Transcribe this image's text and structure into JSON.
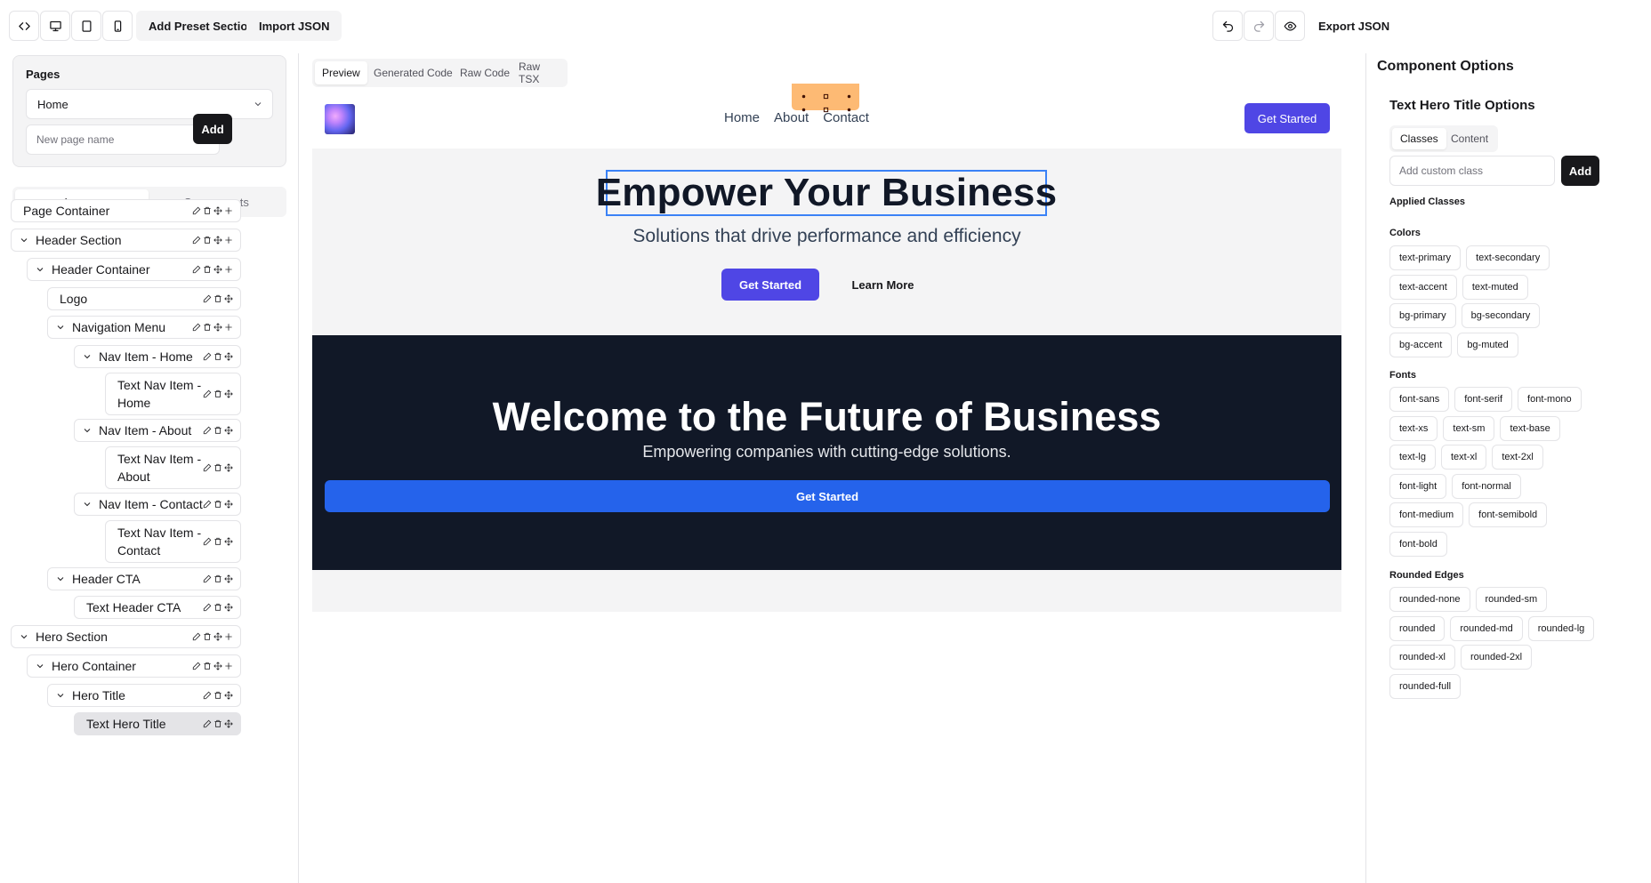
{
  "toolbar": {
    "add_preset": "Add Preset Section",
    "import_json": "Import JSON",
    "export_json": "Export JSON"
  },
  "sidebar": {
    "pages_title": "Pages",
    "selected_page": "Home",
    "new_page_placeholder": "New page name",
    "add_label": "Add",
    "tabs": [
      "Layers",
      "Components"
    ],
    "layers": [
      {
        "label": "Page Container"
      },
      {
        "label": "Header Section"
      },
      {
        "label": "Header Container"
      },
      {
        "label": "Logo"
      },
      {
        "label": "Navigation Menu"
      },
      {
        "label": "Nav Item - Home"
      },
      {
        "label": "Text Nav Item - Home"
      },
      {
        "label": "Nav Item - About"
      },
      {
        "label": "Text Nav Item - About"
      },
      {
        "label": "Nav Item - Contact"
      },
      {
        "label": "Text Nav Item - Contact"
      },
      {
        "label": "Header CTA"
      },
      {
        "label": "Text Header CTA"
      },
      {
        "label": "Hero Section"
      },
      {
        "label": "Hero Container"
      },
      {
        "label": "Hero Title"
      },
      {
        "label": "Text Hero Title"
      }
    ]
  },
  "center": {
    "view_tabs": [
      "Preview",
      "Generated Code",
      "Raw Code",
      "Raw TSX"
    ],
    "site": {
      "nav": [
        "Home",
        "About",
        "Contact"
      ],
      "header_cta": "Get Started",
      "hero_title": "Empower Your Business",
      "hero_subtitle": "Solutions that drive performance and efficiency",
      "hero_primary": "Get Started",
      "hero_secondary": "Learn More",
      "dark_title": "Welcome to the Future of Business",
      "dark_subtitle": "Empowering companies with cutting-edge solutions.",
      "dark_cta": "Get Started"
    }
  },
  "rpanel": {
    "title": "Component Options",
    "subtitle": "Text Hero Title Options",
    "tabs": [
      "Classes",
      "Content"
    ],
    "custom_placeholder": "Add custom class",
    "add_label": "Add",
    "applied_label": "Applied Classes",
    "colors_label": "Colors",
    "colors": [
      [
        "text-primary",
        "text-secondary"
      ],
      [
        "text-accent",
        "text-muted"
      ],
      [
        "bg-primary",
        "bg-secondary"
      ],
      [
        "bg-accent",
        "bg-muted"
      ]
    ],
    "fonts_label": "Fonts",
    "fonts": [
      [
        "font-sans",
        "font-serif",
        "font-mono"
      ],
      [
        "text-xs",
        "text-sm",
        "text-base"
      ],
      [
        "text-lg",
        "text-xl",
        "text-2xl"
      ],
      [
        "font-light",
        "font-normal"
      ],
      [
        "font-medium",
        "font-semibold"
      ],
      [
        "font-bold"
      ]
    ],
    "rounded_label": "Rounded Edges",
    "rounded": [
      [
        "rounded-none",
        "rounded-sm"
      ],
      [
        "rounded",
        "rounded-md",
        "rounded-lg"
      ],
      [
        "rounded-xl",
        "rounded-2xl"
      ],
      [
        "rounded-full"
      ]
    ]
  },
  "colors": {
    "brand": "#4f46e5",
    "dark_section": "#111827",
    "dark_cta": "#2563eb",
    "float_toolbar": "#fdba74"
  }
}
